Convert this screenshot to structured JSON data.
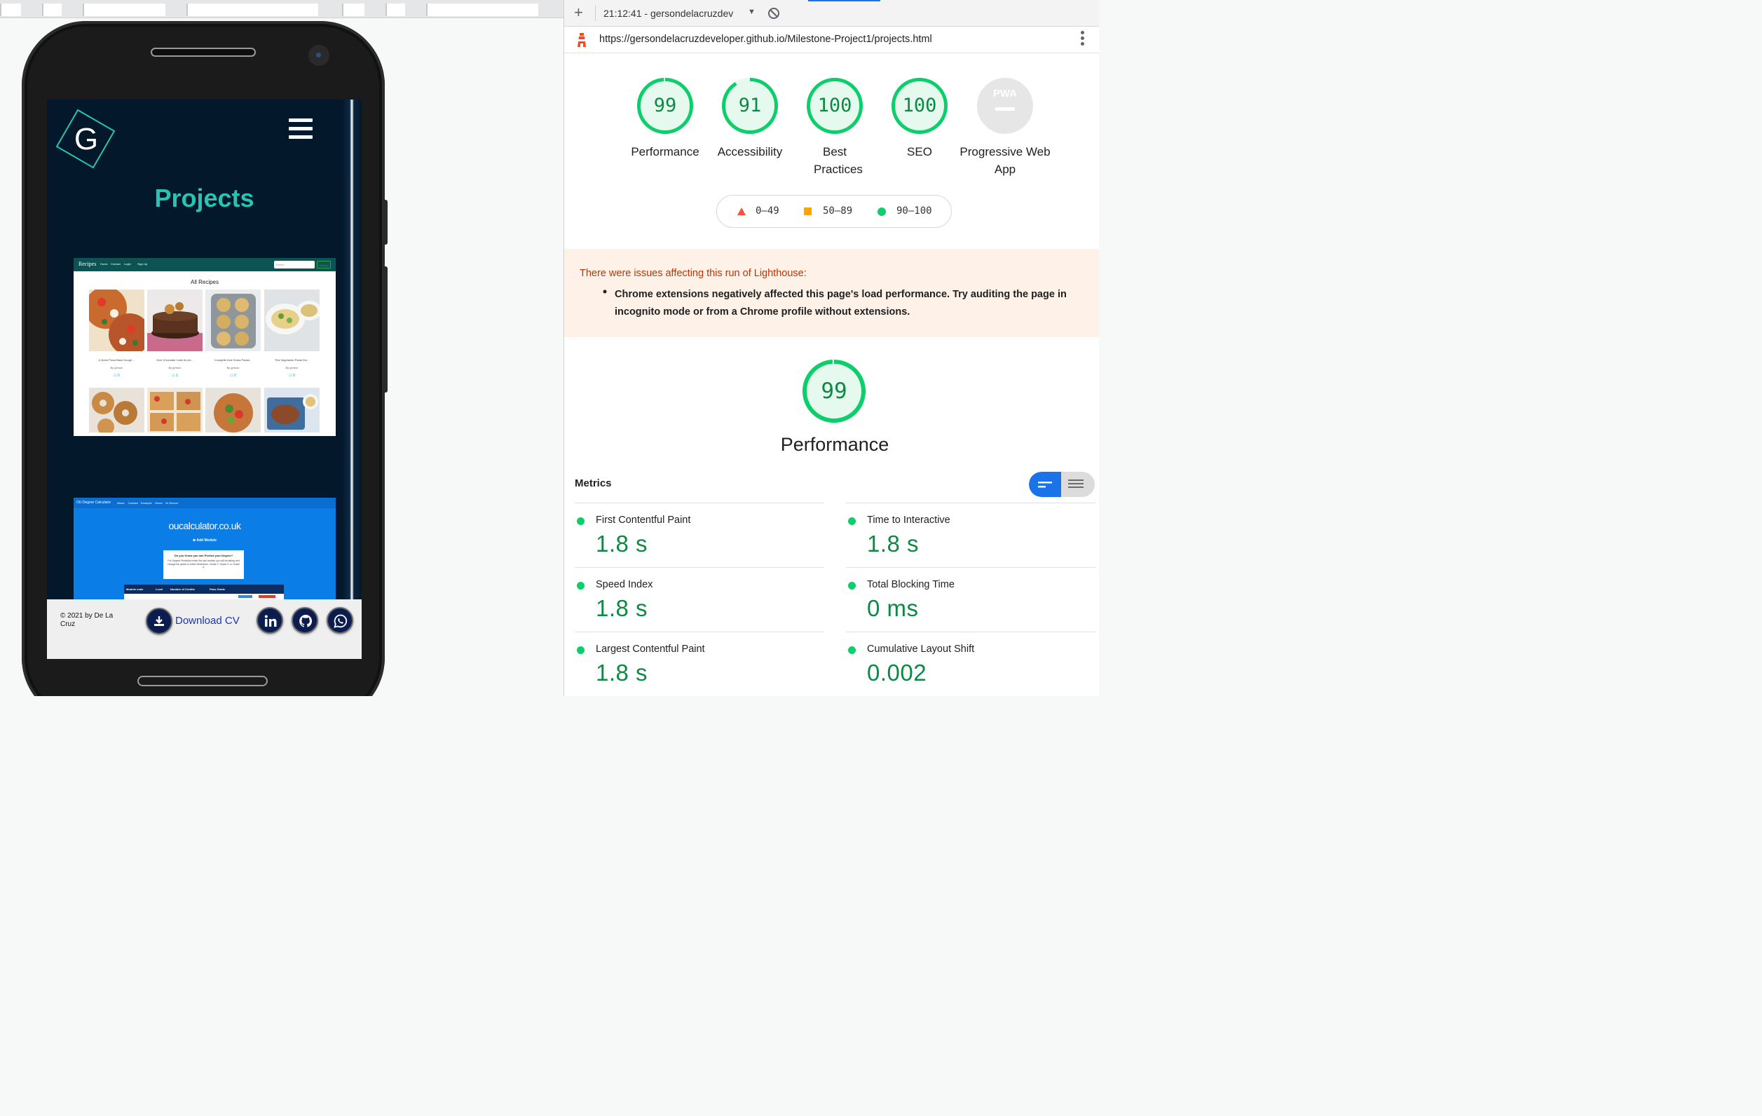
{
  "devtools": {
    "session": "21:12:41 - gersondelacruzdev",
    "url": "https://gersondelacruzdeveloper.github.io/Milestone-Project1/projects.html"
  },
  "site": {
    "logo_letter": "G",
    "page_heading": "Projects",
    "recipes_preview": {
      "brand": "Recipes",
      "nav": [
        "Home",
        "Contact",
        "Login",
        "Sign Up"
      ],
      "search_placeholder": "Search",
      "search_button": "Search",
      "heading": "All Recipes",
      "cards": [
        {
          "name": "A Quick Pizza Base Dough ...",
          "by": "By gerson",
          "comments": "0"
        },
        {
          "name": "Give Chocolate Cake An Au...",
          "by": "By gerson",
          "comments": "1"
        },
        {
          "name": "Courgette And Grana Padan...",
          "by": "By gerson",
          "comments": "0"
        },
        {
          "name": "This Vegetarian Pasta Dis...",
          "by": "By gerson",
          "comments": "0"
        }
      ]
    },
    "calculator_preview": {
      "brand": "OU Degree Calculator",
      "nav": [
        "About",
        "Contact",
        "Example",
        "Home",
        "Hi Gerson"
      ],
      "title": "oucalculator.co.uk",
      "add_module": "Add Module",
      "question": "Do you Know you can Predict your Degree?",
      "body": "For Degree Prediction enter the last module you will be taking and change the grade to either Distinction, Grade 2, Grade 3, or Grade 4.",
      "columns": [
        "Module code",
        "Level",
        "Number of Credits",
        "Pass Grade"
      ]
    },
    "footer": {
      "copyright": "© 2021 by De La Cruz",
      "download_cv": "Download CV",
      "social_icons": [
        "linkedin-icon",
        "github-icon",
        "whatsapp-icon"
      ]
    }
  },
  "lighthouse": {
    "scores": [
      {
        "value": "99",
        "label": "Performance",
        "fraction": 0.99
      },
      {
        "value": "91",
        "label": "Accessibility",
        "fraction": 0.91
      },
      {
        "value": "100",
        "label": "Best Practices",
        "fraction": 1.0
      },
      {
        "value": "100",
        "label": "SEO",
        "fraction": 1.0
      }
    ],
    "pwa": {
      "badge": "PWA",
      "label": "Progressive Web App"
    },
    "legend": [
      {
        "range": "0–49",
        "color": "#ff4e42"
      },
      {
        "range": "50–89",
        "color": "#ffa400"
      },
      {
        "range": "90–100",
        "color": "#0cce6b"
      }
    ],
    "warning": {
      "title": "There were issues affecting this run of Lighthouse:",
      "item": "Chrome extensions negatively affected this page's load performance. Try auditing the page in incognito mode or from a Chrome profile without extensions."
    },
    "performance": {
      "score": "99",
      "fraction": 0.99,
      "label": "Performance"
    },
    "metrics_heading": "Metrics",
    "metrics": [
      {
        "name": "First Contentful Paint",
        "value": "1.8 s"
      },
      {
        "name": "Time to Interactive",
        "value": "1.8 s"
      },
      {
        "name": "Speed Index",
        "value": "1.8 s"
      },
      {
        "name": "Total Blocking Time",
        "value": "0 ms"
      },
      {
        "name": "Largest Contentful Paint",
        "value": "1.8 s"
      },
      {
        "name": "Cumulative Layout Shift",
        "value": "0.002"
      }
    ],
    "colors": {
      "pass": "#0cce6b",
      "pass_text": "#0c8a45",
      "accent": "#1a73e8"
    }
  }
}
